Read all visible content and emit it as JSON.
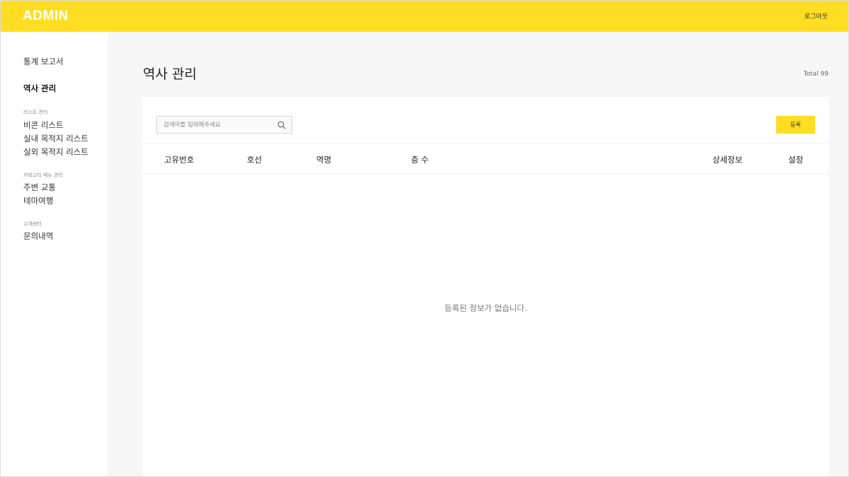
{
  "header": {
    "logo": "ADMIN",
    "logout_label": "로그아웃",
    "accent_color": "#FFDD22"
  },
  "sidebar": {
    "stats_report": "통계 보고서",
    "station_management": "역사 관리",
    "sections": [
      {
        "title": "리스트 관리",
        "items": [
          "비콘 리스트",
          "실내 목적지 리스트",
          "실외 목적지 리스트"
        ]
      },
      {
        "title": "카테고리 메뉴 관리",
        "items": [
          "주변 교통",
          "테마여행"
        ]
      },
      {
        "title": "고객센터",
        "items": [
          "문의내역"
        ]
      }
    ]
  },
  "main": {
    "title": "역사 관리",
    "total": "Total 99",
    "search": {
      "placeholder": "검색어를 입력해주세요",
      "value": ""
    },
    "register_label": "등록",
    "table": {
      "columns": [
        "고유번호",
        "호선",
        "역명",
        "층 수",
        "상세정보",
        "설정"
      ],
      "rows": []
    },
    "empty_message": "등록된 정보가 없습니다."
  }
}
